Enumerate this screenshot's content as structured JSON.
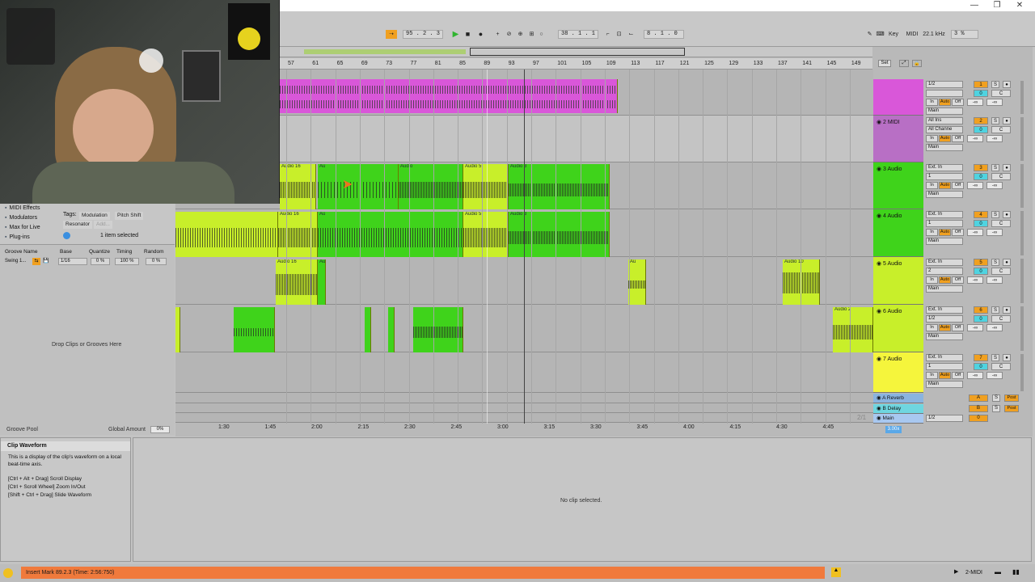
{
  "window": {
    "min_icon": "minimize-icon",
    "max_icon": "restore-icon",
    "close_icon": "close-icon",
    "min": "—",
    "max": "❐",
    "close": "✕"
  },
  "transport": {
    "tempo": "95 . 2 . 3",
    "position": "38 . 1 . 1",
    "loop_length": "8 . 1 . 0",
    "key_label": "Key",
    "midi_label": "MIDI",
    "sample_rate": "22.1 kHz",
    "cpu": "3 %"
  },
  "ruler": {
    "bars": [
      "57",
      "61",
      "65",
      "69",
      "73",
      "77",
      "81",
      "85",
      "89",
      "93",
      "97",
      "101",
      "105",
      "109",
      "113",
      "117",
      "121",
      "125",
      "129",
      "133",
      "137",
      "141",
      "145",
      "149"
    ],
    "set_label": "Set"
  },
  "browser": {
    "items": [
      {
        "label": "MIDI Effects",
        "icon": "midi-effects-icon"
      },
      {
        "label": "Modulators",
        "icon": "modulators-icon"
      },
      {
        "label": "Max for Live",
        "icon": "max-icon"
      },
      {
        "label": "Plug-ins",
        "icon": "plugin-icon"
      }
    ],
    "tags_label": "Tags:",
    "tags": [
      "Modulation",
      "Pitch Shift",
      "Resonator",
      "Add..."
    ],
    "selection": "1 item selected"
  },
  "groove": {
    "headers": [
      "Groove Name",
      "Base",
      "Quantize",
      "Timing",
      "Random"
    ],
    "row": {
      "name": "Swing 1...",
      "base": "1/16",
      "quantize": "0 %",
      "timing": "100 %",
      "random": "0 %"
    },
    "drop_text": "Drop Clips or Grooves Here",
    "pool_label": "Groove Pool",
    "global_amount_label": "Global Amount",
    "global_amount": "0%"
  },
  "tracks": [
    {
      "name": "",
      "number": "1",
      "input": "1/2",
      "color": "#d957d9",
      "monitor": [
        "In",
        "Auto",
        "Off"
      ],
      "output": "Main",
      "vol": "-∞",
      "send": "-∞"
    },
    {
      "name": "2 MIDI",
      "number": "2",
      "input": "All Ins",
      "input2": "All Channe",
      "color": "#b86fc5",
      "monitor": [
        "In",
        "Auto",
        "Off"
      ],
      "output": "Main",
      "vol": "-∞",
      "send": "-∞"
    },
    {
      "name": "3 Audio",
      "number": "3",
      "input": "Ext. In",
      "input2": "1",
      "color": "#3fd31b",
      "monitor": [
        "In",
        "Auto",
        "Off"
      ],
      "output": "Main",
      "vol": "-∞",
      "send": "-∞"
    },
    {
      "name": "4 Audio",
      "number": "4",
      "input": "Ext. In",
      "input2": "1",
      "color": "#3fd31b",
      "monitor": [
        "In",
        "Auto",
        "Off"
      ],
      "output": "Main",
      "vol": "-∞",
      "send": "-∞"
    },
    {
      "name": "5 Audio",
      "number": "5",
      "input": "Ext. In",
      "input2": "2",
      "color": "#c8ef2a",
      "monitor": [
        "In",
        "Auto",
        "Off"
      ],
      "output": "Main",
      "vol": "-∞",
      "send": "-∞"
    },
    {
      "name": "6 Audio",
      "number": "6",
      "input": "Ext. In",
      "input2": "1/2",
      "color": "#c8ef2a",
      "monitor": [
        "In",
        "Auto",
        "Off"
      ],
      "output": "Main",
      "vol": "-∞",
      "send": "-∞"
    },
    {
      "name": "7 Audio",
      "number": "7",
      "input": "Ext. In",
      "input2": "1",
      "color": "#f5f53c",
      "monitor": [
        "In",
        "Auto",
        "Off"
      ],
      "output": "Main",
      "vol": "-∞",
      "send": "-∞"
    }
  ],
  "returns": [
    {
      "name": "A Reverb",
      "letter": "A",
      "color": "#8ab4e0",
      "post": "Post"
    },
    {
      "name": "B Delay",
      "letter": "B",
      "color": "#6fd6e0",
      "post": "Post"
    },
    {
      "name": "Main",
      "letter": "0",
      "color": "#a8c8f0",
      "input": "1/2"
    }
  ],
  "clips": {
    "audio16": "Audio 16",
    "audio5": "Audio 5",
    "audio3": "Audio 3",
    "audio10": "Audio 10",
    "audio2": "Audio 2",
    "a": "A",
    "au": "Au",
    "audio": "Audio"
  },
  "timeline": {
    "times": [
      "1:30",
      "1:45",
      "2:00",
      "2:15",
      "2:30",
      "2:45",
      "3:00",
      "3:15",
      "3:30",
      "3:45",
      "4:00",
      "4:15",
      "4:30",
      "4:45"
    ],
    "zoom": "3.00x",
    "page": "2/1"
  },
  "info": {
    "title": "Clip Waveform",
    "body": "This is a display of the clip's waveform on a local beat-time axis.",
    "hints": [
      "[Ctrl + Alt + Drag] Scroll Display",
      "[Ctrl + Scroll Wheel] Zoom In/Out",
      "[Shift + Ctrl + Drag] Slide Waveform"
    ]
  },
  "detail": {
    "empty": "No clip selected."
  },
  "status": {
    "message": "Insert Mark 89.2.3 (Time: 2:56:750)",
    "track": "2-MIDI"
  }
}
